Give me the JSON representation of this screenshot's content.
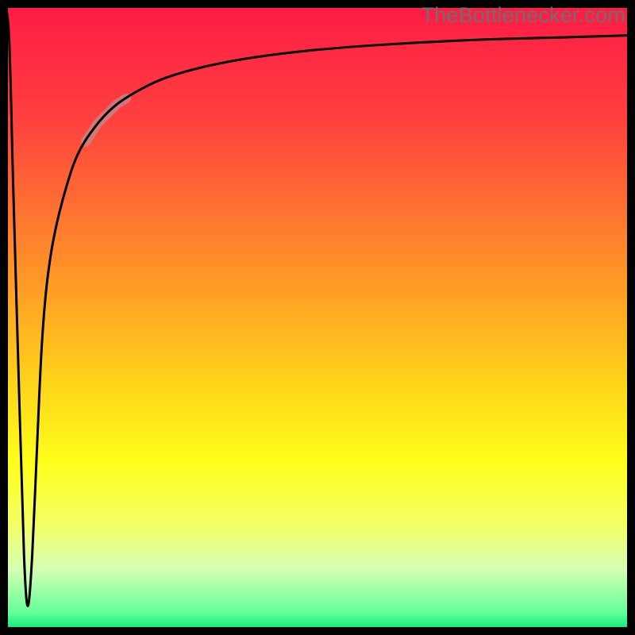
{
  "watermark": "TheBottleneсker.com",
  "chart_data": {
    "type": "line",
    "title": "",
    "xlabel": "",
    "ylabel": "",
    "xlim": [
      0,
      100
    ],
    "ylim": [
      0,
      100
    ],
    "grid": false,
    "background_gradient": {
      "stops": [
        {
          "offset": 0.0,
          "color": "#ff1a45"
        },
        {
          "offset": 0.18,
          "color": "#ff3f3f"
        },
        {
          "offset": 0.4,
          "color": "#ff8a2a"
        },
        {
          "offset": 0.6,
          "color": "#ffd21a"
        },
        {
          "offset": 0.73,
          "color": "#ffff1a"
        },
        {
          "offset": 0.83,
          "color": "#f3ff66"
        },
        {
          "offset": 0.9,
          "color": "#d6ffb3"
        },
        {
          "offset": 0.97,
          "color": "#66ff99"
        },
        {
          "offset": 1.0,
          "color": "#00e676"
        }
      ]
    },
    "series": [
      {
        "name": "bottleneck-curve",
        "x": [
          0.0,
          0.8,
          1.5,
          2.5,
          3.2,
          3.8,
          4.5,
          5.3,
          6.0,
          6.8,
          8.0,
          10.0,
          12.0,
          15.0,
          18.0,
          22.0,
          26.0,
          32.0,
          40.0,
          50.0,
          62.0,
          76.0,
          90.0,
          100.0
        ],
        "y": [
          100.0,
          95.0,
          70.0,
          35.0,
          12.0,
          4.0,
          12.0,
          30.0,
          45.0,
          55.0,
          63.0,
          71.0,
          76.5,
          81.0,
          84.0,
          86.5,
          88.3,
          90.0,
          91.5,
          92.7,
          93.6,
          94.3,
          94.7,
          95.0
        ]
      }
    ],
    "highlight_segment": {
      "series": "bottleneck-curve",
      "x_start": 13.0,
      "x_end": 19.5,
      "color": "#bf8b8d",
      "width": 12
    },
    "frame": {
      "color": "#000000",
      "width": 10
    },
    "curve_style": {
      "color": "#000000",
      "width": 3
    }
  }
}
